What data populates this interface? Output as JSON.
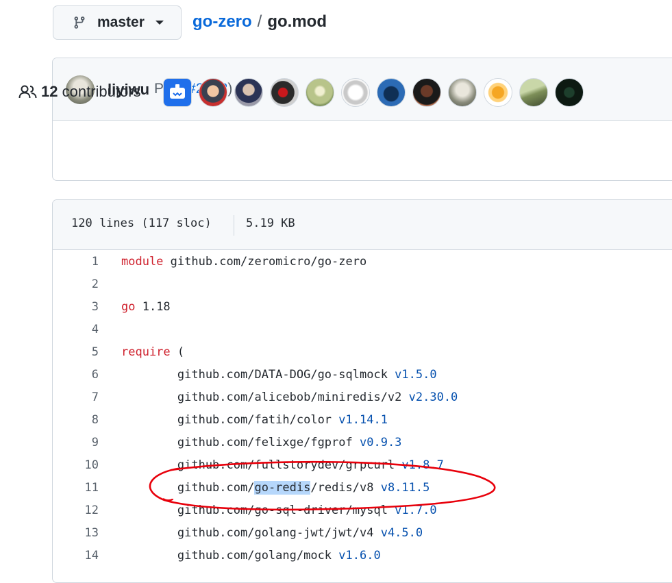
{
  "branch": {
    "name": "master",
    "icon": "git-branch-icon"
  },
  "breadcrumb": {
    "repo": "go-zero",
    "separator": "/",
    "file": "go.mod"
  },
  "commit": {
    "author": "liyiwu",
    "message": "Pgx (",
    "pr_link": "#2902",
    "message_end": ")",
    "ellipsis": "…",
    "status_icon": "x-icon",
    "status_color": "#cf222e"
  },
  "contributors": {
    "count": "12",
    "label": "contributors",
    "avatars": [
      "bot-avatar",
      "user-avatar-2",
      "user-avatar-3",
      "user-avatar-4",
      "user-avatar-5",
      "user-avatar-6",
      "user-avatar-7",
      "user-avatar-8",
      "user-avatar-9",
      "user-avatar-10",
      "user-avatar-11",
      "user-avatar-12"
    ]
  },
  "file": {
    "lines_info": "120 lines (117 sloc)",
    "size": "5.19 KB"
  },
  "code_lines": [
    {
      "n": "1",
      "kw": "module",
      "text": " github.com/zeromicro/go-zero",
      "ver": ""
    },
    {
      "n": "2",
      "kw": "",
      "text": "",
      "ver": ""
    },
    {
      "n": "3",
      "kw": "go",
      "text": " 1.18",
      "ver": ""
    },
    {
      "n": "4",
      "kw": "",
      "text": "",
      "ver": ""
    },
    {
      "n": "5",
      "kw": "require",
      "text": " (",
      "ver": ""
    },
    {
      "n": "6",
      "kw": "",
      "text": "\tgithub.com/DATA-DOG/go-sqlmock ",
      "ver": "v1.5.0"
    },
    {
      "n": "7",
      "kw": "",
      "text": "\tgithub.com/alicebob/miniredis/v2 ",
      "ver": "v2.30.0"
    },
    {
      "n": "8",
      "kw": "",
      "text": "\tgithub.com/fatih/color ",
      "ver": "v1.14.1"
    },
    {
      "n": "9",
      "kw": "",
      "text": "\tgithub.com/felixge/fgprof ",
      "ver": "v0.9.3"
    },
    {
      "n": "10",
      "kw": "",
      "text": "\tgithub.com/fullstorydev/grpcurl ",
      "ver": "v1.8.7"
    },
    {
      "n": "11",
      "kw": "",
      "pre": "\tgithub.com/",
      "hl": "go-redis",
      "text": "/redis/v8 ",
      "ver": "v8.11.5"
    },
    {
      "n": "12",
      "kw": "",
      "text": "\tgithub.com/go-sql-driver/mysql ",
      "ver": "v1.7.0"
    },
    {
      "n": "13",
      "kw": "",
      "text": "\tgithub.com/golang-jwt/jwt/v4 ",
      "ver": "v4.5.0"
    },
    {
      "n": "14",
      "kw": "",
      "text": "\tgithub.com/golang/mock ",
      "ver": "v1.6.0"
    }
  ],
  "colors": {
    "link": "#0969da",
    "keyword": "#cf222e",
    "version": "#0550ae",
    "annotation": "#e8000b"
  }
}
